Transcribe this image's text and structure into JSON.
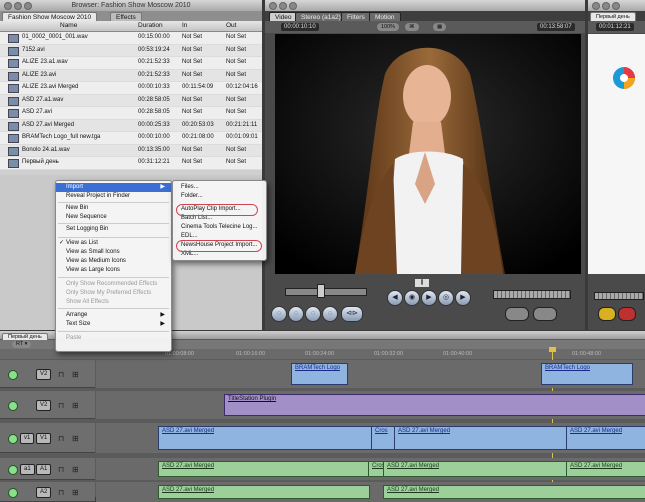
{
  "browser": {
    "window_title": "Browser: Fashion Show Moscow 2010",
    "tabs": [
      "Fashion Show Moscow 2010",
      "Effects"
    ],
    "columns": [
      "Name",
      "Duration",
      "In",
      "Out"
    ],
    "rows": [
      {
        "name": "01_0002_0001_001.wav",
        "duration": "00:15:00:00",
        "in": "Not Set",
        "out": "Not Set"
      },
      {
        "name": "7152.avi",
        "duration": "00:53:19:24",
        "in": "Not Set",
        "out": "Not Set"
      },
      {
        "name": "ALIZE 23.a1.wav",
        "duration": "00:21:52:33",
        "in": "Not Set",
        "out": "Not Set"
      },
      {
        "name": "ALIZE 23.avi",
        "duration": "00:21:52:33",
        "in": "Not Set",
        "out": "Not Set"
      },
      {
        "name": "ALIZE 23.avi Merged",
        "duration": "00:00:10:33",
        "in": "00:11:54:09",
        "out": "00:12:04:16"
      },
      {
        "name": "ASD 27.a1.wav",
        "duration": "00:28:58:05",
        "in": "Not Set",
        "out": "Not Set"
      },
      {
        "name": "ASD 27.avi",
        "duration": "00:28:58:05",
        "in": "Not Set",
        "out": "Not Set"
      },
      {
        "name": "ASD 27.avi Merged",
        "duration": "00:00:25:33",
        "in": "00:20:53:03",
        "out": "00:21:21:11"
      },
      {
        "name": "BRAMTech Logo_full new.tga",
        "duration": "00:00:10:00",
        "in": "00:21:08:00",
        "out": "00:01:09:01"
      },
      {
        "name": "Bonolo 24.a1.wav",
        "duration": "00:13:35:00",
        "in": "Not Set",
        "out": "Not Set"
      },
      {
        "name": "Первый день",
        "duration": "00:31:12:21",
        "in": "Not Set",
        "out": "Not Set"
      }
    ]
  },
  "context_menu": {
    "items": [
      {
        "label": "Import",
        "submenu": true,
        "highlighted": true
      },
      {
        "label": "Reveal Project in Finder"
      },
      {
        "label": "New Bin"
      },
      {
        "label": "New Sequence"
      },
      {
        "label": "Set Logging Bin"
      },
      {
        "label": "View as List",
        "checked": true
      },
      {
        "label": "View as Small Icons"
      },
      {
        "label": "View as Medium Icons"
      },
      {
        "label": "View as Large Icons"
      },
      {
        "label": "Only Show Recommended Effects",
        "disabled": true
      },
      {
        "label": "Only Show My Preferred Effects",
        "disabled": true
      },
      {
        "label": "Show All Effects",
        "disabled": true
      },
      {
        "label": "Arrange",
        "submenu": true
      },
      {
        "label": "Text Size",
        "submenu": true
      },
      {
        "label": "Paste",
        "disabled": true
      }
    ],
    "check_mark": "✓",
    "arrow": "▶"
  },
  "import_submenu": {
    "items": [
      "Files...",
      "Folder...",
      "AutoPlay Clip Import...",
      "Batch List...",
      "Cinema Tools Telecine Log...",
      "EDL...",
      "NewsHouse Project Import...",
      "XML..."
    ]
  },
  "viewer": {
    "tabs": [
      "Video",
      "Stereo (a1a2)",
      "Filters",
      "Motion"
    ],
    "timecode_left": "00:00:10:10",
    "zoom": "100%",
    "timecode_right": "00:13:58:07"
  },
  "canvas": {
    "title": "Первый день",
    "timecode": "00:01:12:21"
  },
  "timeline": {
    "sequence_tab": "Первый день",
    "ruler_marks": [
      "01:00:08:00",
      "01:00:16:00",
      "01:00:24:00",
      "01:00:32:00",
      "01:00:40:00",
      "01:00:48:00"
    ],
    "tracks": [
      {
        "patch": "V2",
        "clips": [
          {
            "label": "BRAMTech Logo"
          },
          {
            "label": "BRAMTech Logo"
          }
        ]
      },
      {
        "patch": "V2",
        "clips": [
          {
            "label": "TitleStation Plugin"
          }
        ]
      },
      {
        "patch": "V1",
        "source": "v1",
        "clips": [
          {
            "label": "ASD 27.avi Merged"
          },
          {
            "label": "ASD 27.avi Merged"
          },
          {
            "label": "Cros"
          },
          {
            "label": "ASD 27.avi Merged"
          },
          {
            "label": "ASD 27.avi Merged"
          }
        ]
      },
      {
        "patch": "A1",
        "source": "a1",
        "clips": [
          {
            "label": "ASD 27.avi Merged"
          },
          {
            "label": "Cros"
          },
          {
            "label": "ASD 27.avi Merged"
          },
          {
            "label": "ASD 27.avi Merged"
          }
        ]
      },
      {
        "patch": "A2",
        "clips": [
          {
            "label": "ASD 27.avi Merged"
          },
          {
            "label": "ASD 27.avi Merged"
          }
        ]
      }
    ]
  },
  "colors": {
    "menu_highlight": "#3b6fd4",
    "circle_outline": "#d0454f",
    "video_clip": "#8fb4e0",
    "audio_clip": "#9ccf9a",
    "generator_clip": "#a38fc7"
  }
}
